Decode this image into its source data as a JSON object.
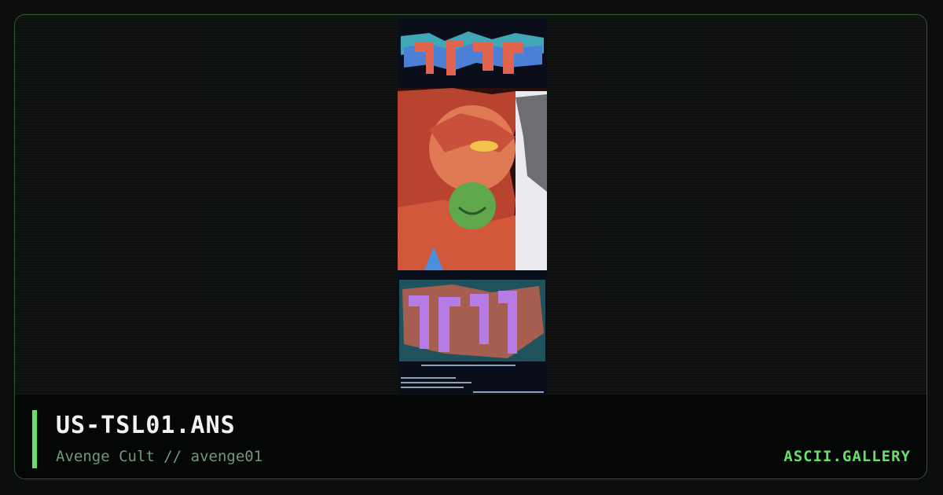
{
  "artwork": {
    "title": "US-TSL01.ANS",
    "group": "Avenge Cult",
    "separator": "//",
    "pack": "avenge01"
  },
  "brand": {
    "label": "ASCII.GALLERY"
  },
  "colors": {
    "accent": "#66e066",
    "border": "#2c5a30",
    "background": "#0b0e0d",
    "footer": "#050606"
  }
}
